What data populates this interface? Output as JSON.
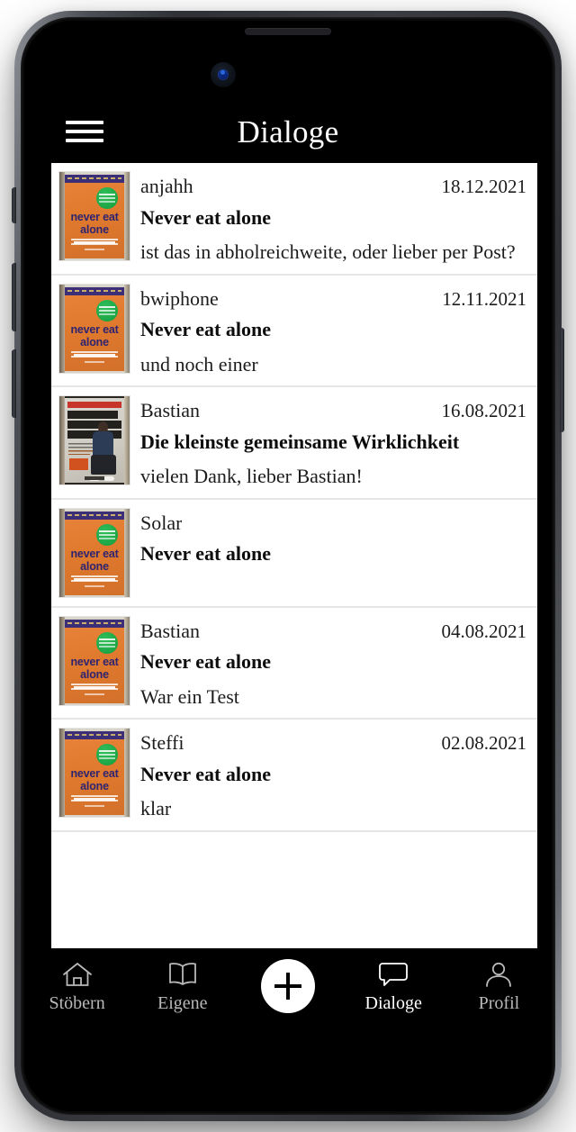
{
  "device": {
    "type": "smartphone",
    "speaker": "earpiece-speaker",
    "camera": "front-camera"
  },
  "appbar": {
    "title": "Dialoge",
    "menu_icon": "hamburger-menu-icon"
  },
  "colors": {
    "chrome": "#000000",
    "sheet": "#ffffff",
    "divider": "#e6e6e6",
    "text": "#1c1c1c",
    "tab_inactive": "#b9b9b9",
    "tab_active": "#ffffff",
    "fab_background": "#ffffff"
  },
  "conversations": [
    {
      "partner": "anjahh",
      "date": "18.12.2021",
      "book_title": "Never eat alone",
      "preview": "ist das in abholreichweite, oder lieber per Post?",
      "cover": "never-eat-alone"
    },
    {
      "partner": "bwiphone",
      "date": "12.11.2021",
      "book_title": "Never eat alone",
      "preview": "und noch einer",
      "cover": "never-eat-alone"
    },
    {
      "partner": "Bastian",
      "date": "16.08.2021",
      "book_title": "Die kleinste gemeinsame Wirklichkeit",
      "preview": "vielen Dank, lieber Bastian!",
      "cover": "die-kleinste-gemeinsame-wirklichkeit"
    },
    {
      "partner": "Solar",
      "date": "",
      "book_title": "Never eat alone",
      "preview": "",
      "cover": "never-eat-alone"
    },
    {
      "partner": "Bastian",
      "date": "04.08.2021",
      "book_title": "Never eat alone",
      "preview": "War ein Test",
      "cover": "never-eat-alone"
    },
    {
      "partner": "Steffi",
      "date": "02.08.2021",
      "book_title": "Never eat alone",
      "preview": "klar",
      "cover": "never-eat-alone"
    }
  ],
  "tabbar": {
    "items": [
      {
        "label": "Stöbern",
        "icon": "home-icon",
        "active": false
      },
      {
        "label": "Eigene",
        "icon": "open-book-icon",
        "active": false
      },
      {
        "label": "",
        "icon": "plus-icon",
        "active": false
      },
      {
        "label": "Dialoge",
        "icon": "chat-bubble-icon",
        "active": true
      },
      {
        "label": "Profil",
        "icon": "person-icon",
        "active": false
      }
    ]
  }
}
